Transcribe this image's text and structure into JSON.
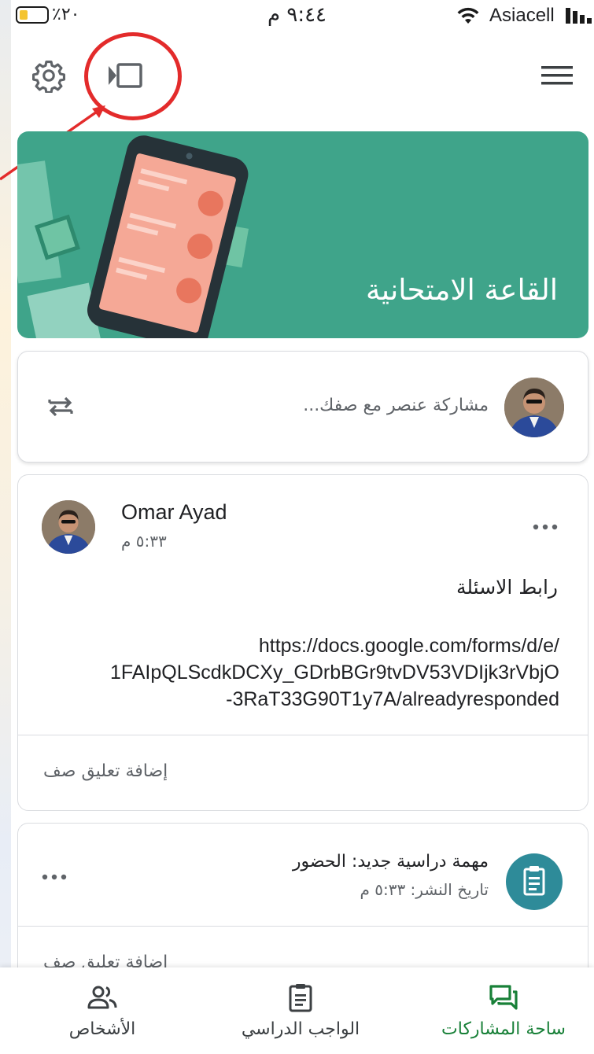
{
  "status_bar": {
    "battery": "٪٢٠",
    "time": "٩:٤٤ م",
    "carrier": "Asiacell"
  },
  "banner": {
    "class_title": "القاعة الامتحانية"
  },
  "share": {
    "placeholder": "مشاركة عنصر مع صفك..."
  },
  "post": {
    "author": "Omar Ayad",
    "time": "٥:٣٣ م",
    "title": "رابط الاسئلة",
    "link_lines": [
      "https://docs.google.com/forms/d/e/",
      "1FAIpQLScdkDCXy_GDrbBGr9tvDV53VDIjk3rVbjO",
      "-3RaT33G90T1y7A/alreadyresponded"
    ],
    "add_comment": "إضافة تعليق صف"
  },
  "assignment": {
    "title": "مهمة دراسية جديد: الحضور",
    "date": "تاريخ النشر: ٥:٣٣ م",
    "add_comment": "إضافة تعليق صف"
  },
  "bottom_nav": {
    "stream": "ساحة المشاركات",
    "classwork": "الواجب الدراسي",
    "people": "الأشخاص"
  },
  "colors": {
    "banner": "#3fa48a",
    "active_tab": "#188038",
    "assignment_icon": "#2e8b99",
    "annotation": "#e32b2b"
  },
  "icons": [
    "gear-icon",
    "present-icon",
    "menu-icon",
    "repost-icon",
    "more-icon",
    "assignment-icon",
    "stream-icon",
    "classwork-icon",
    "people-icon"
  ]
}
